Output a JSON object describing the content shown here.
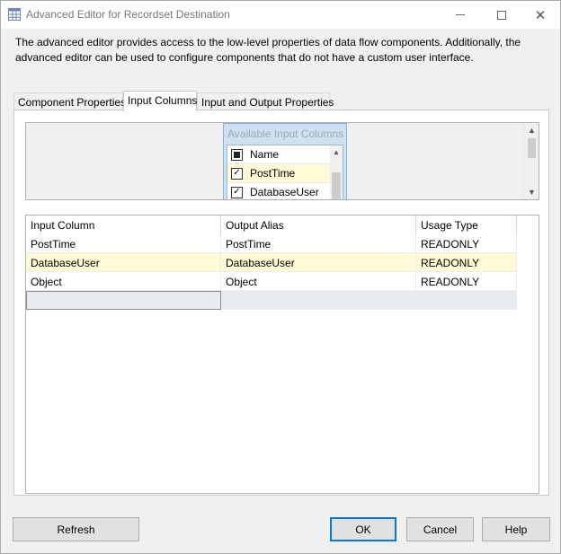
{
  "window": {
    "title": "Advanced Editor for Recordset Destination",
    "app_icon": "grid-table-icon",
    "controls": {
      "minimize_icon": "minimize-icon",
      "maximize_icon": "maximize-icon",
      "close_icon": "close-icon",
      "close_glyph": "✕"
    }
  },
  "description": "The advanced editor provides access to the low-level properties of data flow components. Additionally, the advanced editor can be used to configure components that do not have a custom user interface.",
  "tabs": [
    {
      "label": "Component Properties"
    },
    {
      "label": "Input Columns",
      "active": true
    },
    {
      "label": "Input and Output Properties"
    }
  ],
  "available_columns": {
    "title": "Available Input Columns",
    "header_label": "Name",
    "items": [
      {
        "label": "PostTime",
        "checked": true,
        "check_glyph": "✓"
      },
      {
        "label": "DatabaseUser",
        "checked": true,
        "check_glyph": "✓"
      }
    ]
  },
  "grid": {
    "headers": [
      "Input Column",
      "Output Alias",
      "Usage Type"
    ],
    "rows": [
      [
        "PostTime",
        "PostTime",
        "READONLY"
      ],
      [
        "DatabaseUser",
        "DatabaseUser",
        "READONLY"
      ],
      [
        "Object",
        "Object",
        "READONLY"
      ]
    ]
  },
  "buttons": {
    "refresh": "Refresh",
    "ok": "OK",
    "cancel": "Cancel",
    "help": "Help"
  },
  "colors": {
    "accent": "#0078d7",
    "highlight_row": "#fffbd6",
    "available_panel": "#cfe0f0"
  }
}
